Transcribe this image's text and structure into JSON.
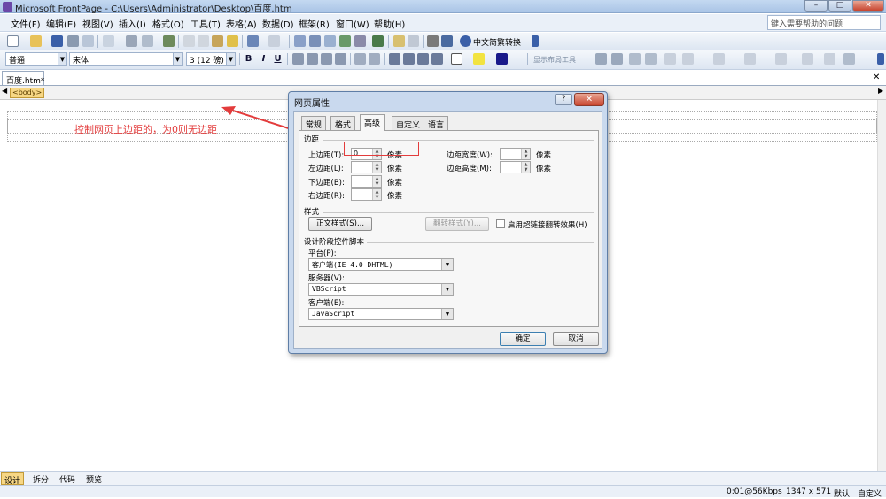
{
  "window": {
    "title": "Microsoft FrontPage - C:\\Users\\Administrator\\Desktop\\百度.htm",
    "min": "–",
    "max": "□",
    "close": "✕"
  },
  "menu": [
    "文件(F)",
    "编辑(E)",
    "视图(V)",
    "插入(I)",
    "格式(O)",
    "工具(T)",
    "表格(A)",
    "数据(D)",
    "框架(R)",
    "窗口(W)",
    "帮助(H)"
  ],
  "help_search": {
    "placeholder": "键入需要帮助的问题"
  },
  "toolbar": {
    "convert_label": "中文简繁转换"
  },
  "format_bar": {
    "style": "普通",
    "font": "宋体",
    "size": "3 (12 磅)",
    "bold": "B",
    "italic": "I",
    "underline": "U",
    "layout_tools": "显示布局工具"
  },
  "document": {
    "tab_label": "百度.htm*",
    "body_tag": "<body>",
    "annotation": "控制网页上边距的，为0则无边距"
  },
  "view_tabs": [
    "设计",
    "拆分",
    "代码",
    "预览"
  ],
  "status": {
    "speed": "0:01@56Kbps",
    "dimensions": "1347 x 571",
    "mode": "默认",
    "custom": "自定义"
  },
  "dialog": {
    "title": "网页属性",
    "help": "?",
    "close": "✕",
    "tabs": [
      "常规",
      "格式",
      "高级",
      "自定义",
      "语言"
    ],
    "active_tab": "高级",
    "margins": {
      "group_label": "边距",
      "top_label": "上边距(T):",
      "top_value": "0",
      "left_label": "左边距(L):",
      "left_value": "",
      "bottom_label": "下边距(B):",
      "bottom_value": "",
      "right_label": "右边距(R):",
      "right_value": "",
      "width_label": "边距宽度(W):",
      "width_value": "",
      "height_label": "边距高度(M):",
      "height_value": "",
      "unit": "像素"
    },
    "styles": {
      "group_label": "样式",
      "body_style_button": "正文样式(S)...",
      "rollover_style_button": "翻转样式(Y)...",
      "rollover_checkbox_label": "启用超链接翻转效果(H)",
      "rollover_checked": false
    },
    "scripting": {
      "group_label": "设计阶段控件脚本",
      "platform_label": "平台(P):",
      "platform_value": "客户端(IE 4.0 DHTML)",
      "server_label": "服务器(V):",
      "server_value": "VBScript",
      "client_label": "客户端(E):",
      "client_value": "JavaScript"
    },
    "ok_button": "确定",
    "cancel_button": "取消"
  }
}
